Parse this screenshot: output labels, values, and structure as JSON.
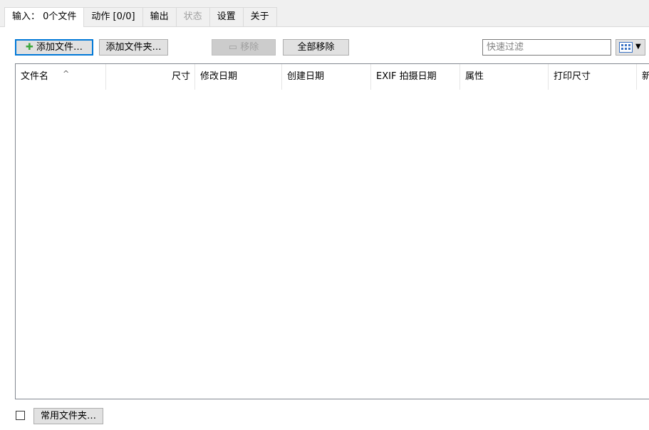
{
  "tabs": [
    {
      "label": "输入： 0个文件",
      "active": true
    },
    {
      "label": "动作 [0/0]"
    },
    {
      "label": "输出"
    },
    {
      "label": "状态",
      "disabled": true
    },
    {
      "label": "设置"
    },
    {
      "label": "关于"
    }
  ],
  "toolbar": {
    "add_files_label": "添加文件…",
    "add_folder_label": "添加文件夹…",
    "remove_label": "移除",
    "remove_all_label": "全部移除",
    "filter_placeholder": "快速过滤"
  },
  "columns": [
    {
      "label": "文件名"
    },
    {
      "label": "尺寸"
    },
    {
      "label": "修改日期"
    },
    {
      "label": "创建日期"
    },
    {
      "label": "EXIF 拍摄日期"
    },
    {
      "label": "属性"
    },
    {
      "label": "打印尺寸"
    },
    {
      "label": "新"
    }
  ],
  "bottom": {
    "favorites_label": "常用文件夹…"
  }
}
